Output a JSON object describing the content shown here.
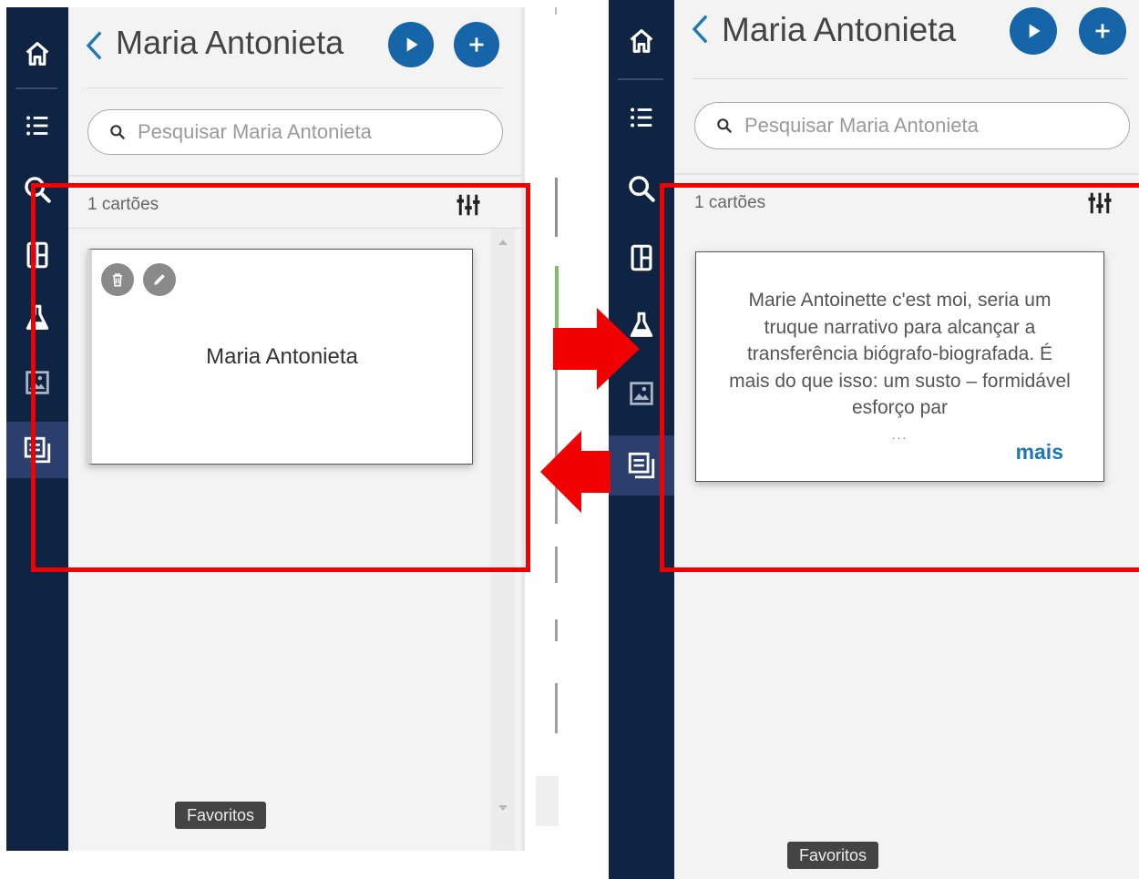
{
  "left": {
    "title": "Maria Antonieta",
    "search_placeholder": "Pesquisar Maria Antonieta",
    "count": "1 cartões",
    "card": {
      "title": "Maria Antonieta"
    },
    "favorites": "Favoritos"
  },
  "right": {
    "title": "Maria Antonieta",
    "search_placeholder": "Pesquisar Maria Antonieta",
    "count": "1 cartões",
    "card": {
      "text": "Marie Antoinette c'est moi, seria um truque narrativo para alcançar a transferência biógrafo-biografada. É mais do que isso: um susto – formidável esforço par",
      "ellipsis": "...",
      "more": "mais"
    },
    "favorites": "Favoritos"
  },
  "sidebar_icons": [
    "home-icon",
    "list-icon",
    "search-icon",
    "layout-icon",
    "flask-icon",
    "image-icon",
    "cards-icon"
  ],
  "colors": {
    "sidebar": "#0f2342",
    "sidebar_active": "#2c3e6e",
    "primary_button": "#1565a8",
    "highlight": "#f00000",
    "link": "#1f77b4"
  }
}
